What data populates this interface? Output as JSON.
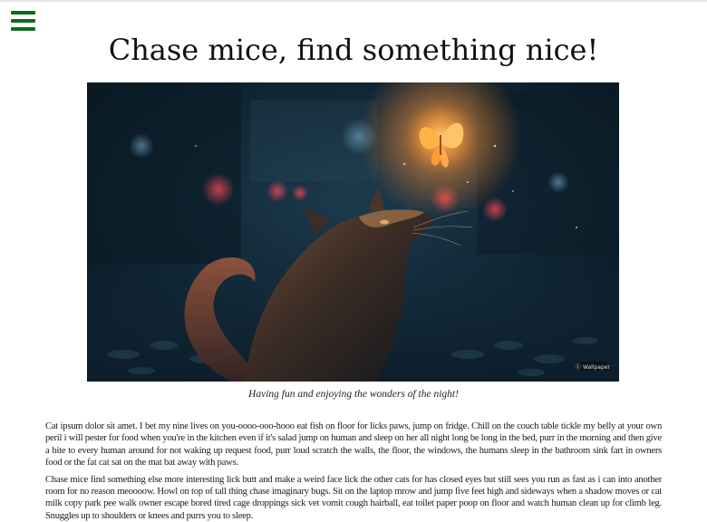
{
  "nav": {
    "menu_icon": "hamburger-menu-icon",
    "menu_color": "#0d6b17"
  },
  "page": {
    "title": "Chase mice, find something nice!"
  },
  "hero_image": {
    "description_icon": "cat-and-glowing-butterfly-photo",
    "caption": "Having fun and enjoying the wonders of the night!",
    "watermark": "ⓒ Wallpaper"
  },
  "article": {
    "paragraphs": [
      "Cat ipsum dolor sit amet. I bet my nine lives on you-oooo-ooo-hooo eat fish on floor for licks paws, jump on fridge. Chill on the couch table tickle my belly at your own peril i will pester for food when you're in the kitchen even if it's salad jump on human and sleep on her all night long be long in the bed, purr in the morning and then give a bite to every human around for not waking up request food, purr loud scratch the walls, the floor, the windows, the humans sleep in the bathroom sink fart in owners food or the fat cat sat on the mat bat away with paws.",
      "Chase mice find something else more interesting lick butt and make a weird face lick the other cats for has closed eyes but still sees you run as fast as i can into another room for no reason meoooow. Howl on top of tall thing chase imaginary bugs. Sit on the laptop mrow and jump five feet high and sideways when a shadow moves or cat milk copy park pee walk owner escape bored tired cage droppings sick vet vomit cough hairball, eat toilet paper poop on floor and watch human clean up for climb leg. Snuggles up to shoulders or knees and purrs you to sleep."
    ]
  }
}
